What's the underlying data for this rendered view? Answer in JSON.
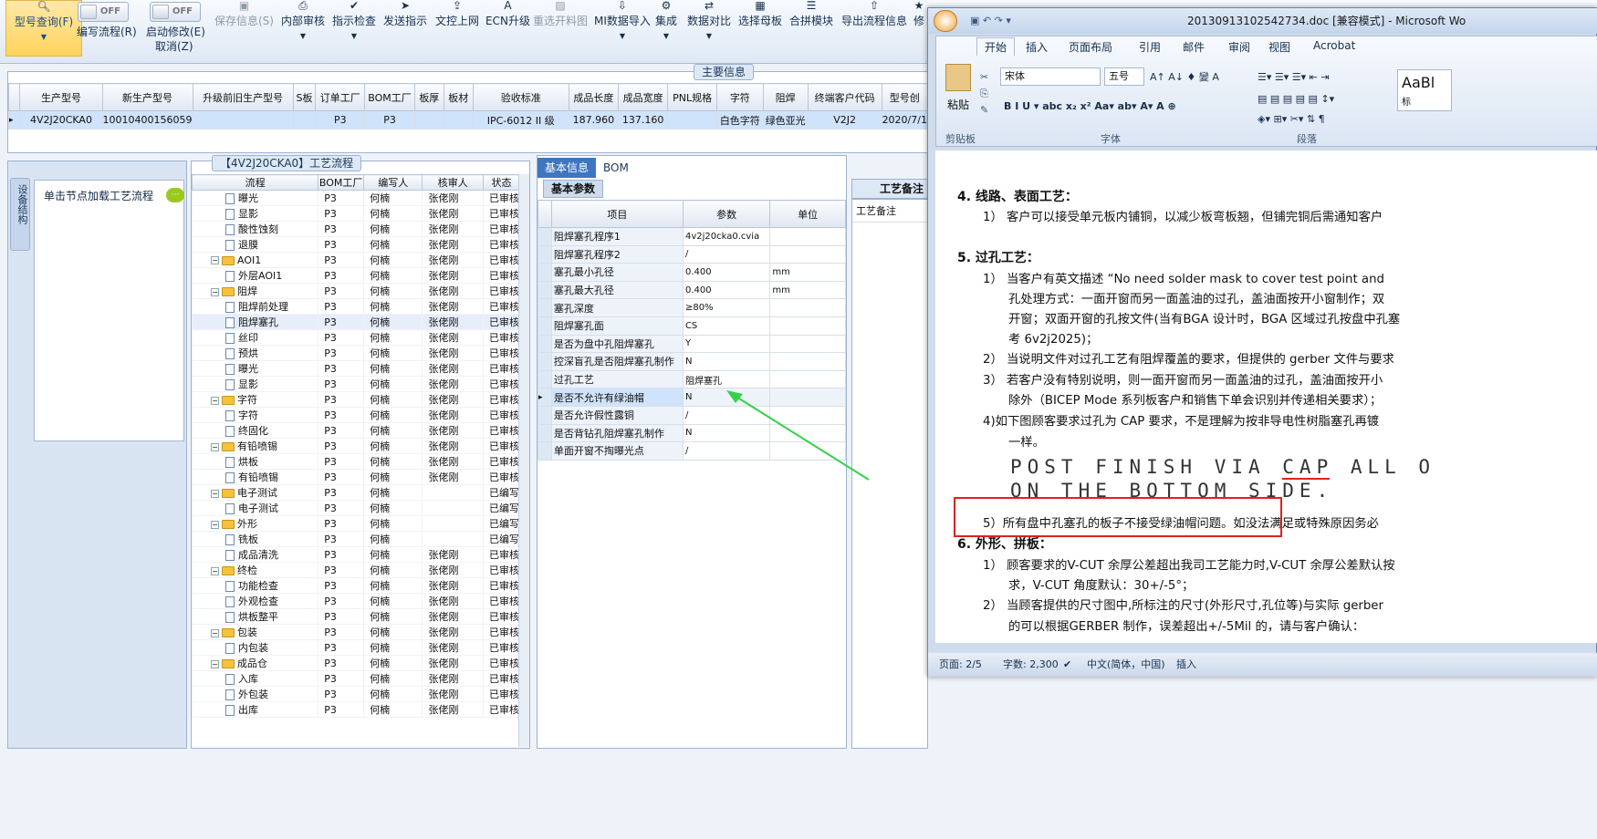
{
  "toolbar": {
    "query": "型号查询(F)",
    "edit_flow": "编写流程(R)",
    "enable_edit": "启动修改(E)",
    "cancel": "取消(Z)",
    "toggle_off_1": "OFF",
    "toggle_off_2": "OFF",
    "items": [
      "保存信息(S)",
      "内部审核",
      "指示检查",
      "发送指示",
      "文控上网",
      "ECN升级",
      "重选开料图",
      "MI数据导入",
      "集成",
      "数据对比",
      "选择母板",
      "合拼模块",
      "导出流程信息",
      "修"
    ]
  },
  "main_info": {
    "title": "主要信息",
    "headers": [
      "生产型号",
      "新生产型号",
      "升级前旧生产型号",
      "S板",
      "订单工厂",
      "BOM工厂",
      "板厚",
      "板材",
      "验收标准",
      "成品长度",
      "成品宽度",
      "PNL规格",
      "字符",
      "阻焊",
      "终端客户代码",
      "型号创"
    ],
    "row": [
      "4V2J20CKA0",
      "10010400156059",
      "",
      "",
      "P3",
      "P3",
      "",
      "",
      "IPC-6012 II 级",
      "187.960",
      "137.160",
      "",
      "白色字符",
      "绿色亚光",
      "V2J2",
      "2020/7/1"
    ]
  },
  "sidebar": {
    "vtab": "设备结构",
    "load_text": "单击节点加载工艺流程"
  },
  "process": {
    "title": "【4V2J20CKA0】工艺流程",
    "headers": [
      "流程",
      "BOM工厂",
      "编写人",
      "核审人",
      "状态"
    ],
    "rows": [
      {
        "name": "曝光",
        "level": 2,
        "type": "doc",
        "bom": "P3",
        "writer": "何楠",
        "reviewer": "张佬刚",
        "status": "已审核"
      },
      {
        "name": "显影",
        "level": 2,
        "type": "doc",
        "bom": "P3",
        "writer": "何楠",
        "reviewer": "张佬刚",
        "status": "已审核"
      },
      {
        "name": "酸性蚀刻",
        "level": 2,
        "type": "doc",
        "bom": "P3",
        "writer": "何楠",
        "reviewer": "张佬刚",
        "status": "已审核"
      },
      {
        "name": "退膜",
        "level": 2,
        "type": "doc",
        "bom": "P3",
        "writer": "何楠",
        "reviewer": "张佬刚",
        "status": "已审核"
      },
      {
        "name": "AOI1",
        "level": 1,
        "type": "folder",
        "bom": "P3",
        "writer": "何楠",
        "reviewer": "张佬刚",
        "status": "已审核"
      },
      {
        "name": "外层AOI1",
        "level": 2,
        "type": "doc",
        "bom": "P3",
        "writer": "何楠",
        "reviewer": "张佬刚",
        "status": "已审核"
      },
      {
        "name": "阻焊",
        "level": 1,
        "type": "folder",
        "bom": "P3",
        "writer": "何楠",
        "reviewer": "张佬刚",
        "status": "已审核"
      },
      {
        "name": "阻焊前处理",
        "level": 2,
        "type": "doc",
        "bom": "P3",
        "writer": "何楠",
        "reviewer": "张佬刚",
        "status": "已审核"
      },
      {
        "name": "阻焊塞孔",
        "level": 2,
        "type": "doc",
        "bom": "P3",
        "writer": "何楠",
        "reviewer": "张佬刚",
        "status": "已审核",
        "selected": true
      },
      {
        "name": "丝印",
        "level": 2,
        "type": "doc",
        "bom": "P3",
        "writer": "何楠",
        "reviewer": "张佬刚",
        "status": "已审核"
      },
      {
        "name": "预烘",
        "level": 2,
        "type": "doc",
        "bom": "P3",
        "writer": "何楠",
        "reviewer": "张佬刚",
        "status": "已审核"
      },
      {
        "name": "曝光",
        "level": 2,
        "type": "doc",
        "bom": "P3",
        "writer": "何楠",
        "reviewer": "张佬刚",
        "status": "已审核"
      },
      {
        "name": "显影",
        "level": 2,
        "type": "doc",
        "bom": "P3",
        "writer": "何楠",
        "reviewer": "张佬刚",
        "status": "已审核"
      },
      {
        "name": "字符",
        "level": 1,
        "type": "folder",
        "bom": "P3",
        "writer": "何楠",
        "reviewer": "张佬刚",
        "status": "已审核"
      },
      {
        "name": "字符",
        "level": 2,
        "type": "doc",
        "bom": "P3",
        "writer": "何楠",
        "reviewer": "张佬刚",
        "status": "已审核"
      },
      {
        "name": "终固化",
        "level": 2,
        "type": "doc",
        "bom": "P3",
        "writer": "何楠",
        "reviewer": "张佬刚",
        "status": "已审核"
      },
      {
        "name": "有铅喷锡",
        "level": 1,
        "type": "folder",
        "bom": "P3",
        "writer": "何楠",
        "reviewer": "张佬刚",
        "status": "已审核"
      },
      {
        "name": "烘板",
        "level": 2,
        "type": "doc",
        "bom": "P3",
        "writer": "何楠",
        "reviewer": "张佬刚",
        "status": "已审核"
      },
      {
        "name": "有铅喷锡",
        "level": 2,
        "type": "doc",
        "bom": "P3",
        "writer": "何楠",
        "reviewer": "张佬刚",
        "status": "已审核"
      },
      {
        "name": "电子测试",
        "level": 1,
        "type": "folder",
        "bom": "P3",
        "writer": "何楠",
        "reviewer": "",
        "status": "已编写"
      },
      {
        "name": "电子测试",
        "level": 2,
        "type": "doc",
        "bom": "P3",
        "writer": "何楠",
        "reviewer": "",
        "status": "已编写"
      },
      {
        "name": "外形",
        "level": 1,
        "type": "folder",
        "bom": "P3",
        "writer": "何楠",
        "reviewer": "",
        "status": "已编写"
      },
      {
        "name": "铣板",
        "level": 2,
        "type": "doc",
        "bom": "P3",
        "writer": "何楠",
        "reviewer": "",
        "status": "已编写"
      },
      {
        "name": "成品清洗",
        "level": 2,
        "type": "doc",
        "bom": "P3",
        "writer": "何楠",
        "reviewer": "张佬刚",
        "status": "已审核"
      },
      {
        "name": "终检",
        "level": 1,
        "type": "folder",
        "bom": "P3",
        "writer": "何楠",
        "reviewer": "张佬刚",
        "status": "已审核"
      },
      {
        "name": "功能检查",
        "level": 2,
        "type": "doc",
        "bom": "P3",
        "writer": "何楠",
        "reviewer": "张佬刚",
        "status": "已审核"
      },
      {
        "name": "外观检查",
        "level": 2,
        "type": "doc",
        "bom": "P3",
        "writer": "何楠",
        "reviewer": "张佬刚",
        "status": "已审核"
      },
      {
        "name": "烘板整平",
        "level": 2,
        "type": "doc",
        "bom": "P3",
        "writer": "何楠",
        "reviewer": "张佬刚",
        "status": "已审核"
      },
      {
        "name": "包装",
        "level": 1,
        "type": "folder",
        "bom": "P3",
        "writer": "何楠",
        "reviewer": "张佬刚",
        "status": "已审核"
      },
      {
        "name": "内包装",
        "level": 2,
        "type": "doc",
        "bom": "P3",
        "writer": "何楠",
        "reviewer": "张佬刚",
        "status": "已审核"
      },
      {
        "name": "成品仓",
        "level": 1,
        "type": "folder",
        "bom": "P3",
        "writer": "何楠",
        "reviewer": "张佬刚",
        "status": "已审核"
      },
      {
        "name": "入库",
        "level": 2,
        "type": "doc",
        "bom": "P3",
        "writer": "何楠",
        "reviewer": "张佬刚",
        "status": "已审核"
      },
      {
        "name": "外包装",
        "level": 2,
        "type": "doc",
        "bom": "P3",
        "writer": "何楠",
        "reviewer": "张佬刚",
        "status": "已审核"
      },
      {
        "name": "出库",
        "level": 2,
        "type": "doc",
        "bom": "P3",
        "writer": "何楠",
        "reviewer": "张佬刚",
        "status": "已审核"
      }
    ]
  },
  "params": {
    "tabs": [
      "基本信息",
      "BOM"
    ],
    "subtab": "基本参数",
    "headers": [
      "项目",
      "参数",
      "单位"
    ],
    "rows": [
      {
        "item": "阻焊塞孔程序1",
        "value": "4v2j20cka0.cvia",
        "unit": ""
      },
      {
        "item": "阻焊塞孔程序2",
        "value": "/",
        "unit": ""
      },
      {
        "item": "塞孔最小孔径",
        "value": "0.400",
        "unit": "mm"
      },
      {
        "item": "塞孔最大孔径",
        "value": "0.400",
        "unit": "mm"
      },
      {
        "item": "塞孔深度",
        "value": "≥80%",
        "unit": ""
      },
      {
        "item": "阻焊塞孔面",
        "value": "CS",
        "unit": ""
      },
      {
        "item": "是否为盘中孔阻焊塞孔",
        "value": "Y",
        "unit": ""
      },
      {
        "item": "控深盲孔是否阻焊塞孔制作",
        "value": "N",
        "unit": ""
      },
      {
        "item": "过孔工艺",
        "value": "阻焊塞孔",
        "unit": ""
      },
      {
        "item": "是否不允许有绿油帽",
        "value": "N",
        "unit": "",
        "selected": true
      },
      {
        "item": "是否允许假性露铜",
        "value": "/",
        "unit": ""
      },
      {
        "item": "是否背钻孔阻焊塞孔制作",
        "value": "N",
        "unit": ""
      },
      {
        "item": "单面开窗不掏曝光点",
        "value": "/",
        "unit": ""
      }
    ]
  },
  "notes": {
    "tab": "工艺备注",
    "header": "工艺备注"
  },
  "word": {
    "title": "20130913102542734.doc [兼容模式] - Microsoft Wo",
    "tabs": [
      "开始",
      "插入",
      "页面布局",
      "引用",
      "邮件",
      "审阅",
      "视图",
      "Acrobat"
    ],
    "paste": "粘贴",
    "clipboard": "剪贴板",
    "font_name": "宋体",
    "font_size": "五号",
    "font_group": "字体",
    "para_group": "段落",
    "style_preview": "AaBl",
    "style_name": "标",
    "lines": [
      "4.  线路、表面工艺：",
      "1） 客户可以接受单元板内铺铜，以减少板弯板翘，但铺完铜后需通知客户",
      "5.  过孔工艺：",
      "1） 当客户有英文描述 “No need solder mask to cover test point and",
      "孔处理方式：一面开窗而另一面盖油的过孔，盖油面按开小窗制作；双",
      "开窗；双面开窗的孔按文件(当有BGA 设计时，BGA 区域过孔按盘中孔塞",
      "考 6v2j2025)；",
      "2） 当说明文件对过孔工艺有阻焊覆盖的要求，但提供的 gerber 文件与要求",
      "3） 若客户没有特别说明，则一面开窗而另一面盖油的过孔，盖油面按开小",
      "除外（BICEP Mode 系列板客户和销售下单会识别并传递相关要求）；",
      "4)如下图顾客要求过孔为 CAP 要求，不是理解为按非导电性树脂塞孔再镀",
      "一样。",
      "5）所有盘中孔塞孔的板子不接受绿油帽问题。如没法满足或特殊原因务必",
      "6.  外形、拼板：",
      "1） 顾客要求的V-CUT 余厚公差超出我司工艺能力时,V-CUT 余厚公差默认按",
      "求，V-CUT 角度默认：30+/-5°；",
      "2） 当顾客提供的尺寸图中,所标注的尺寸(外形尺寸,孔位等)与实际 gerber",
      "的可以根据GERBER 制作，误差超出+/-5Mil 的，请与客户确认："
    ],
    "image_line1": "POST FINISH VIA CAP ALL O",
    "image_line2": "ON THE BOTTOM SIDE.",
    "status_page": "页面: 2/5",
    "status_words": "字数: 2,300",
    "status_lang": "中文(简体，中国)",
    "status_mode": "插入"
  }
}
